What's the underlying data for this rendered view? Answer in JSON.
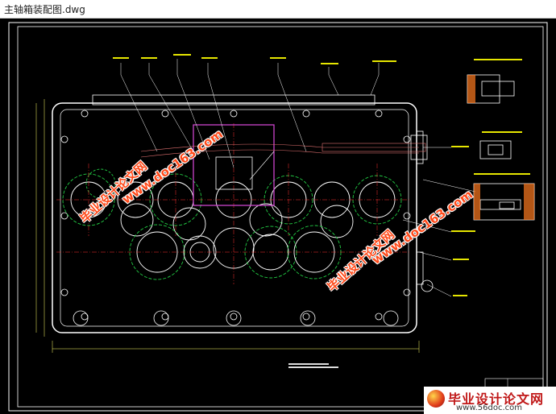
{
  "window": {
    "title": "主轴箱装配图.dwg"
  },
  "drawing": {
    "background_color": "#000000",
    "frame_color": "#ffffff",
    "housing_color": "#ffffff",
    "gear_color": "#ffffff",
    "circle_green": "#22cc44",
    "center_line_red": "#ff3333",
    "purple_part": "#cc44cc",
    "label_yellow": "#e6e600"
  },
  "watermarks": [
    {
      "text": "毕业设计论文网"
    },
    {
      "text": "www.doc163.com"
    },
    {
      "text": "毕业设计论文网"
    },
    {
      "text": "www.doc163.com"
    }
  ],
  "logo": {
    "name": "毕业设计论文网",
    "url": "www.56doc.com"
  }
}
